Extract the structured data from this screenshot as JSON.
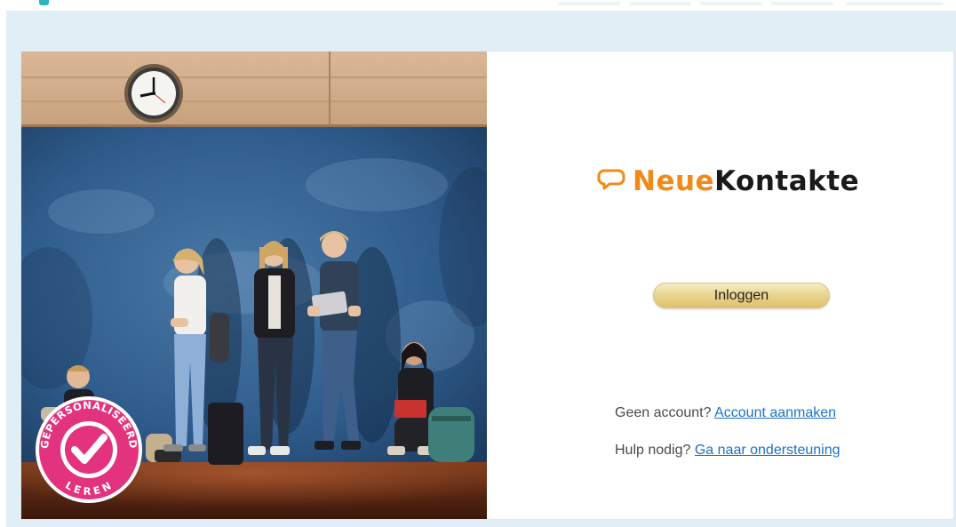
{
  "brand": {
    "name_part1": "Neue",
    "name_part2": "Kontakte",
    "accent_color": "#f08a18",
    "text_color": "#1a1a1a",
    "icon": "speech-bubbles-icon"
  },
  "login": {
    "button_label": "Inloggen",
    "button_color": "#e4cd80"
  },
  "links": {
    "account_prompt": "Geen account?",
    "account_link": "Account aanmaken",
    "help_prompt": "Hulp nodig?",
    "help_link": "Ga naar ondersteuning",
    "link_color": "#1a73c9"
  },
  "badge": {
    "top_text": "GEPERSONALISEERD",
    "bottom_text": "LEREN",
    "color": "#e3337f",
    "icon": "checkmark-icon"
  },
  "photo": {
    "description_icon": "students-photo"
  },
  "colors": {
    "frame_background": "#e2eef5",
    "card_background": "#ffffff",
    "top_accent": "#2bb5b8"
  }
}
